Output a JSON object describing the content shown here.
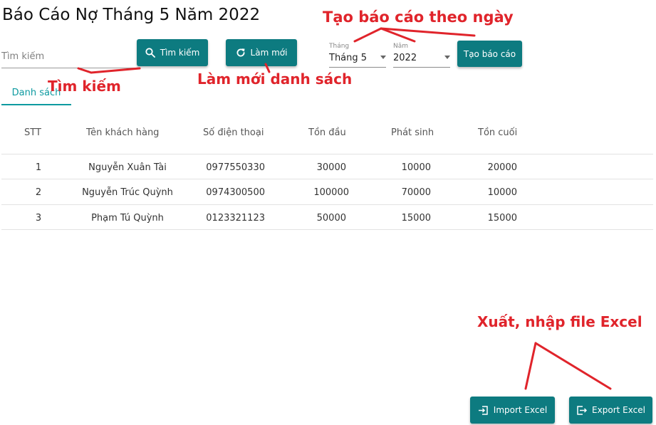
{
  "page_title": "Báo Cáo Nợ Tháng 5 Năm 2022",
  "search": {
    "placeholder": "Tìm kiếm",
    "button_label": "Tìm kiếm"
  },
  "refresh_button_label": "Làm mới",
  "month_select": {
    "label": "Tháng",
    "value": "Tháng 5"
  },
  "year_select": {
    "label": "Năm",
    "value": "2022"
  },
  "create_report_label": "Tạo báo cáo",
  "tab_label": "Danh sách",
  "table": {
    "headers": [
      "STT",
      "Tên khách hàng",
      "Số điện thoại",
      "Tồn đầu",
      "Phát sinh",
      "Tồn cuối"
    ],
    "rows": [
      [
        "1",
        "Nguyễn Xuân Tài",
        "0977550330",
        "30000",
        "10000",
        "20000"
      ],
      [
        "2",
        "Nguyễn Trúc Quỳnh",
        "0974300500",
        "100000",
        "70000",
        "10000"
      ],
      [
        "3",
        "Phạm Tú Quỳnh",
        "0123321123",
        "50000",
        "15000",
        "15000"
      ]
    ]
  },
  "import_label": "Import Excel",
  "export_label": "Export Excel",
  "annotations": {
    "create_by_date": "Tạo báo cáo theo ngày",
    "search": "Tìm kiếm",
    "refresh_list": "Làm mới danh sách",
    "excel": "Xuất, nhập file Excel"
  },
  "colors": {
    "primary": "#0d7b80",
    "tab_active": "#0d9aa0",
    "annotation": "#e0242b"
  }
}
